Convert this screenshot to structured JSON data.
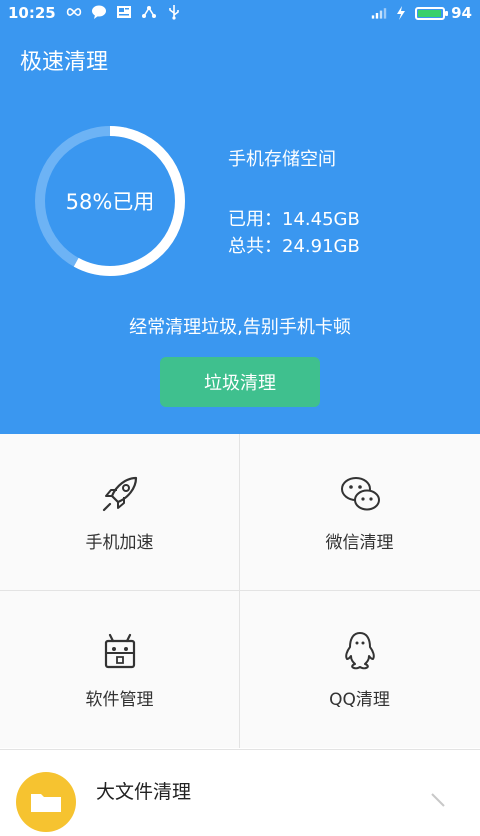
{
  "status_bar": {
    "time": "10:25",
    "battery_level": "94",
    "battery_fill_fraction": 0.94
  },
  "header": {
    "title": "极速清理",
    "usage_percent": 58,
    "usage_label": "58%已用",
    "storage_title": "手机存储空间",
    "used_label": "已用：14.45GB",
    "total_label": "总共：24.91GB",
    "slogan": "经常清理垃圾,告别手机卡顿",
    "clean_button": "垃圾清理"
  },
  "grid": {
    "items": [
      {
        "label": "手机加速",
        "icon": "rocket-icon"
      },
      {
        "label": "微信清理",
        "icon": "wechat-icon"
      },
      {
        "label": "软件管理",
        "icon": "android-icon"
      },
      {
        "label": "QQ清理",
        "icon": "qq-penguin-icon"
      }
    ]
  },
  "big_file": {
    "label": "大文件清理",
    "icon": "folder-icon"
  },
  "colors": {
    "primary_blue": "#3a97f0",
    "button_green": "#3fc08e",
    "folder_yellow": "#f6c330",
    "battery_green": "#3ad06a"
  }
}
